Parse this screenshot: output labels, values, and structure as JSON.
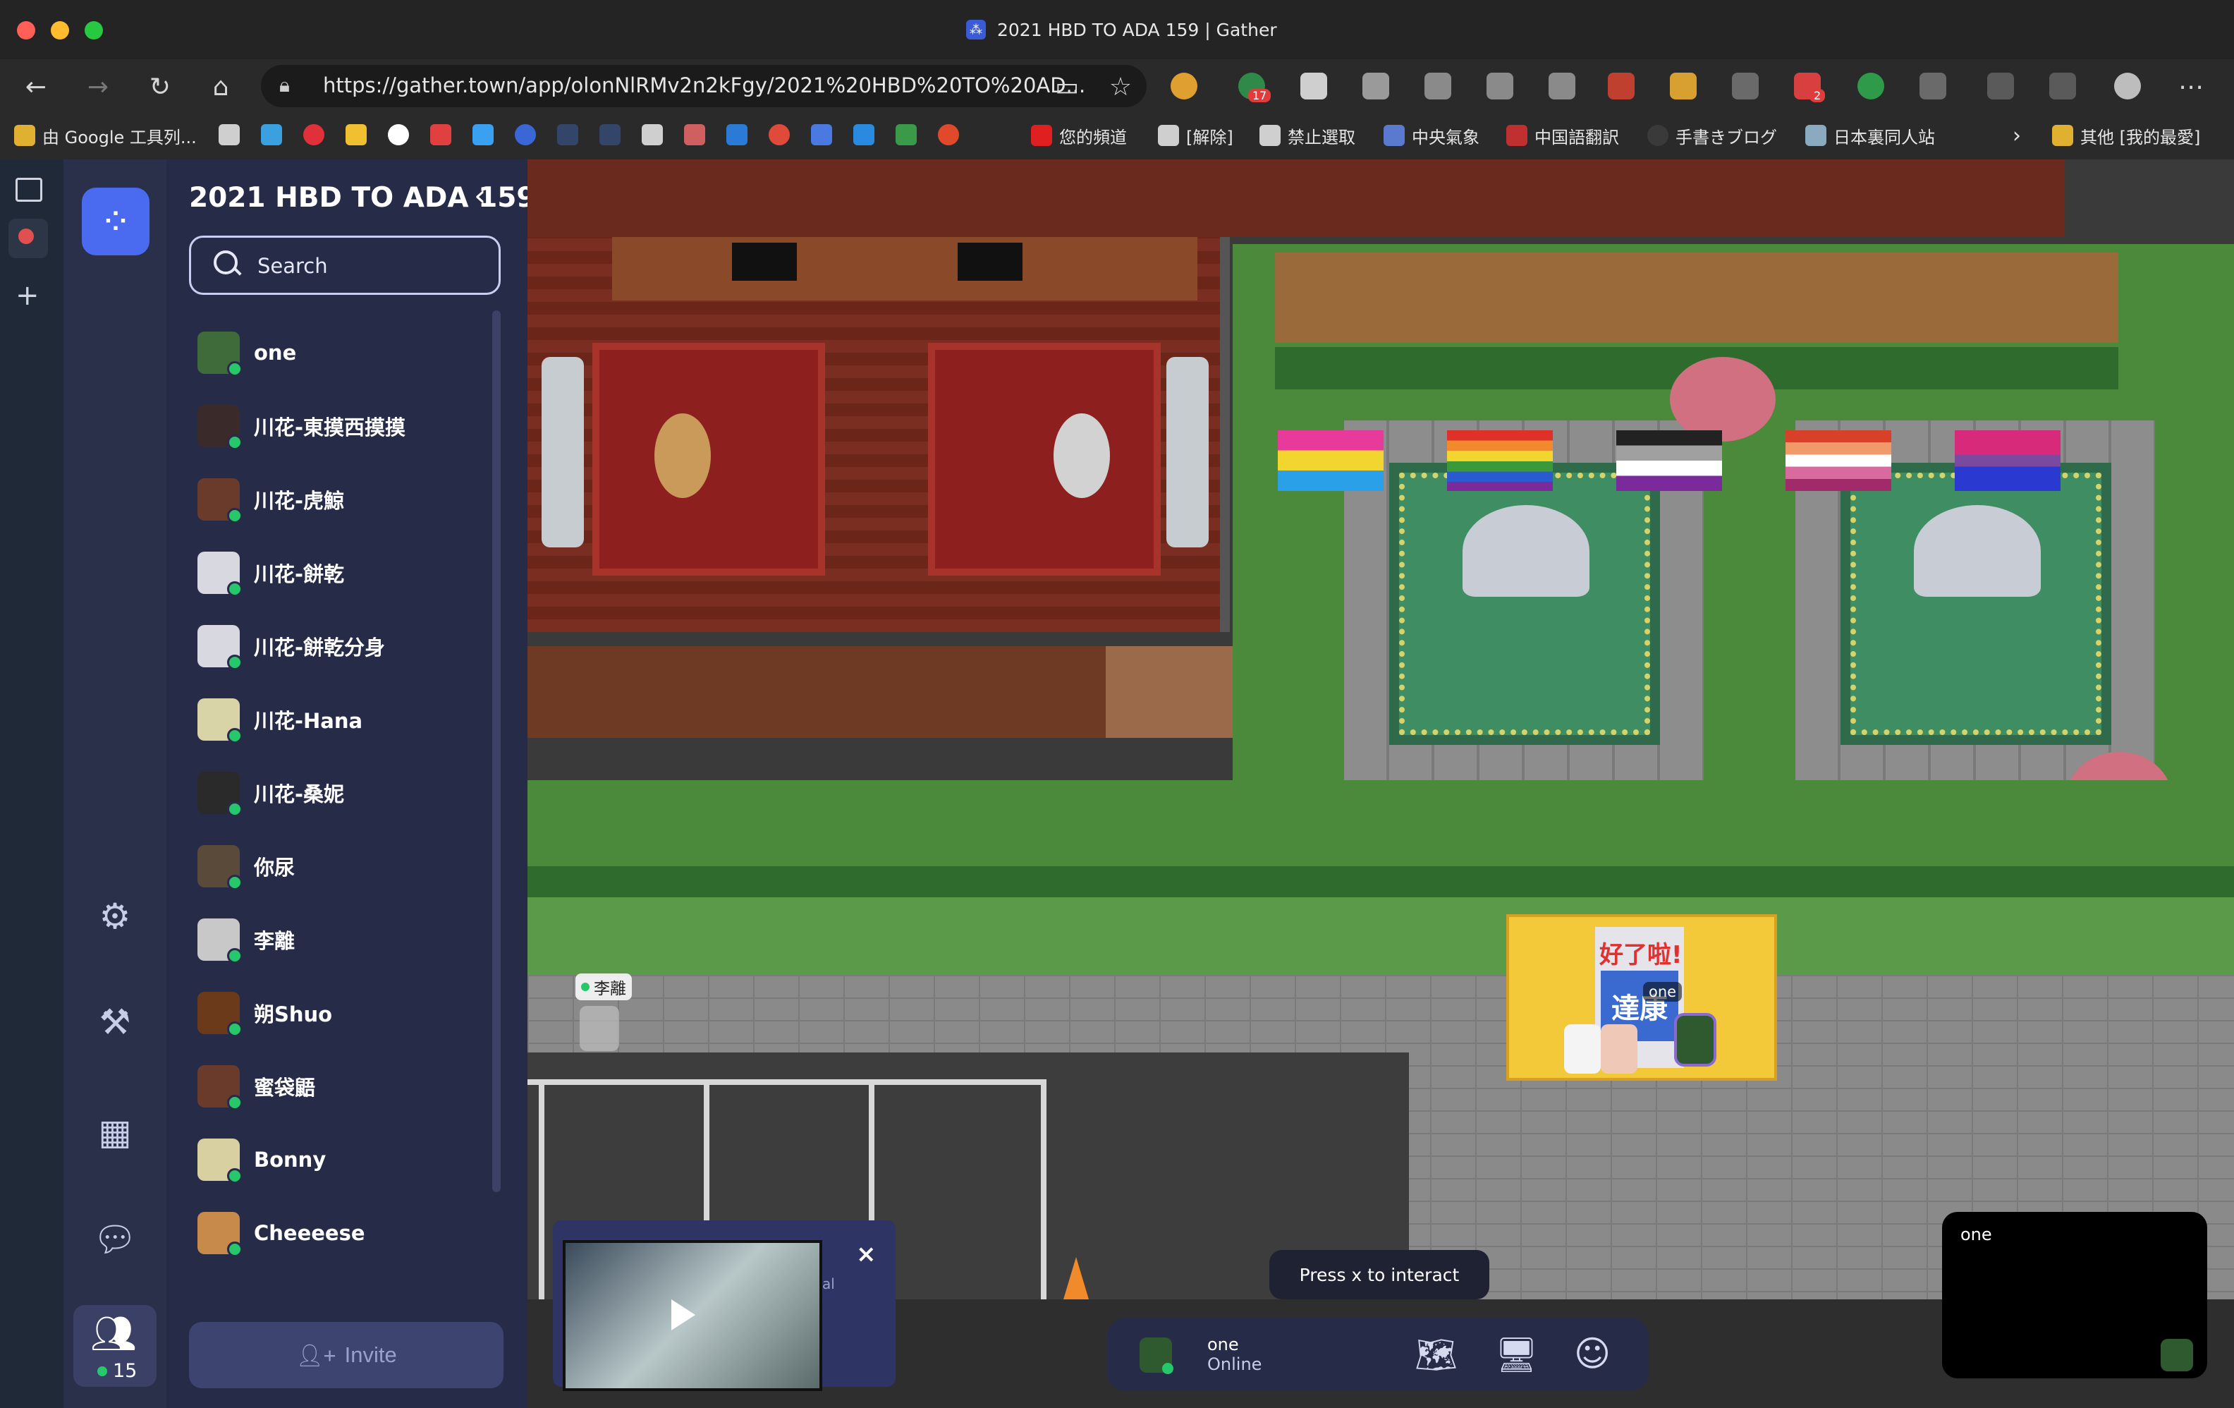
{
  "browser": {
    "tab_title": "2021 HBD TO ADA 159 | Gather",
    "url": "https://gather.town/app/olonNlRMv2n2kFgy/2021%20HBD%20TO%20AD...",
    "bookmarks": [
      "由 Google 工具列...",
      "您的頻道",
      "[解除]",
      "禁止選取",
      "中央氣象",
      "中国語翻訳",
      "手書きブログ",
      "日本裏同人站"
    ],
    "other_bookmarks": "其他 [我的最愛]",
    "badges": [
      "17",
      "2"
    ]
  },
  "sidebar": {
    "title": "2021 HBD TO ADA 159",
    "search_placeholder": "Search",
    "people_count": "15",
    "invite_label": "Invite",
    "users": [
      {
        "name": "one",
        "color": "#3f6b3a"
      },
      {
        "name": "川花-東摸西摸摸",
        "color": "#3a2a2a"
      },
      {
        "name": "川花-虎鯨",
        "color": "#6a3a2a"
      },
      {
        "name": "川花-餅乾",
        "color": "#d8d8e0"
      },
      {
        "name": "川花-餅乾分身",
        "color": "#d8d8e0"
      },
      {
        "name": "川花-Hana",
        "color": "#d9d3a8"
      },
      {
        "name": "川花-桑妮",
        "color": "#2a2a2a"
      },
      {
        "name": "你尿",
        "color": "#5a4a3a"
      },
      {
        "name": "李離",
        "color": "#c8c8c8"
      },
      {
        "name": "朔Shuo",
        "color": "#6a3a1a"
      },
      {
        "name": "蜜袋鼯",
        "color": "#6a3a2a"
      },
      {
        "name": "Bonny",
        "color": "#d8d0a0"
      },
      {
        "name": "Cheeeese",
        "color": "#c88a4a"
      }
    ]
  },
  "map": {
    "player_labels": [
      "李離",
      "one"
    ],
    "sign_text": [
      "好了啦!",
      "達康"
    ],
    "interact_hint": "Press x to interact"
  },
  "video_popup": {
    "close_label": "×",
    "caption_fragment": "al"
  },
  "bottom_bar": {
    "name": "one",
    "status": "Online"
  },
  "self_view": {
    "name": "one"
  },
  "colors": {
    "accent": "#4a6bf0",
    "online": "#26c86b",
    "panel": "#262b48"
  }
}
